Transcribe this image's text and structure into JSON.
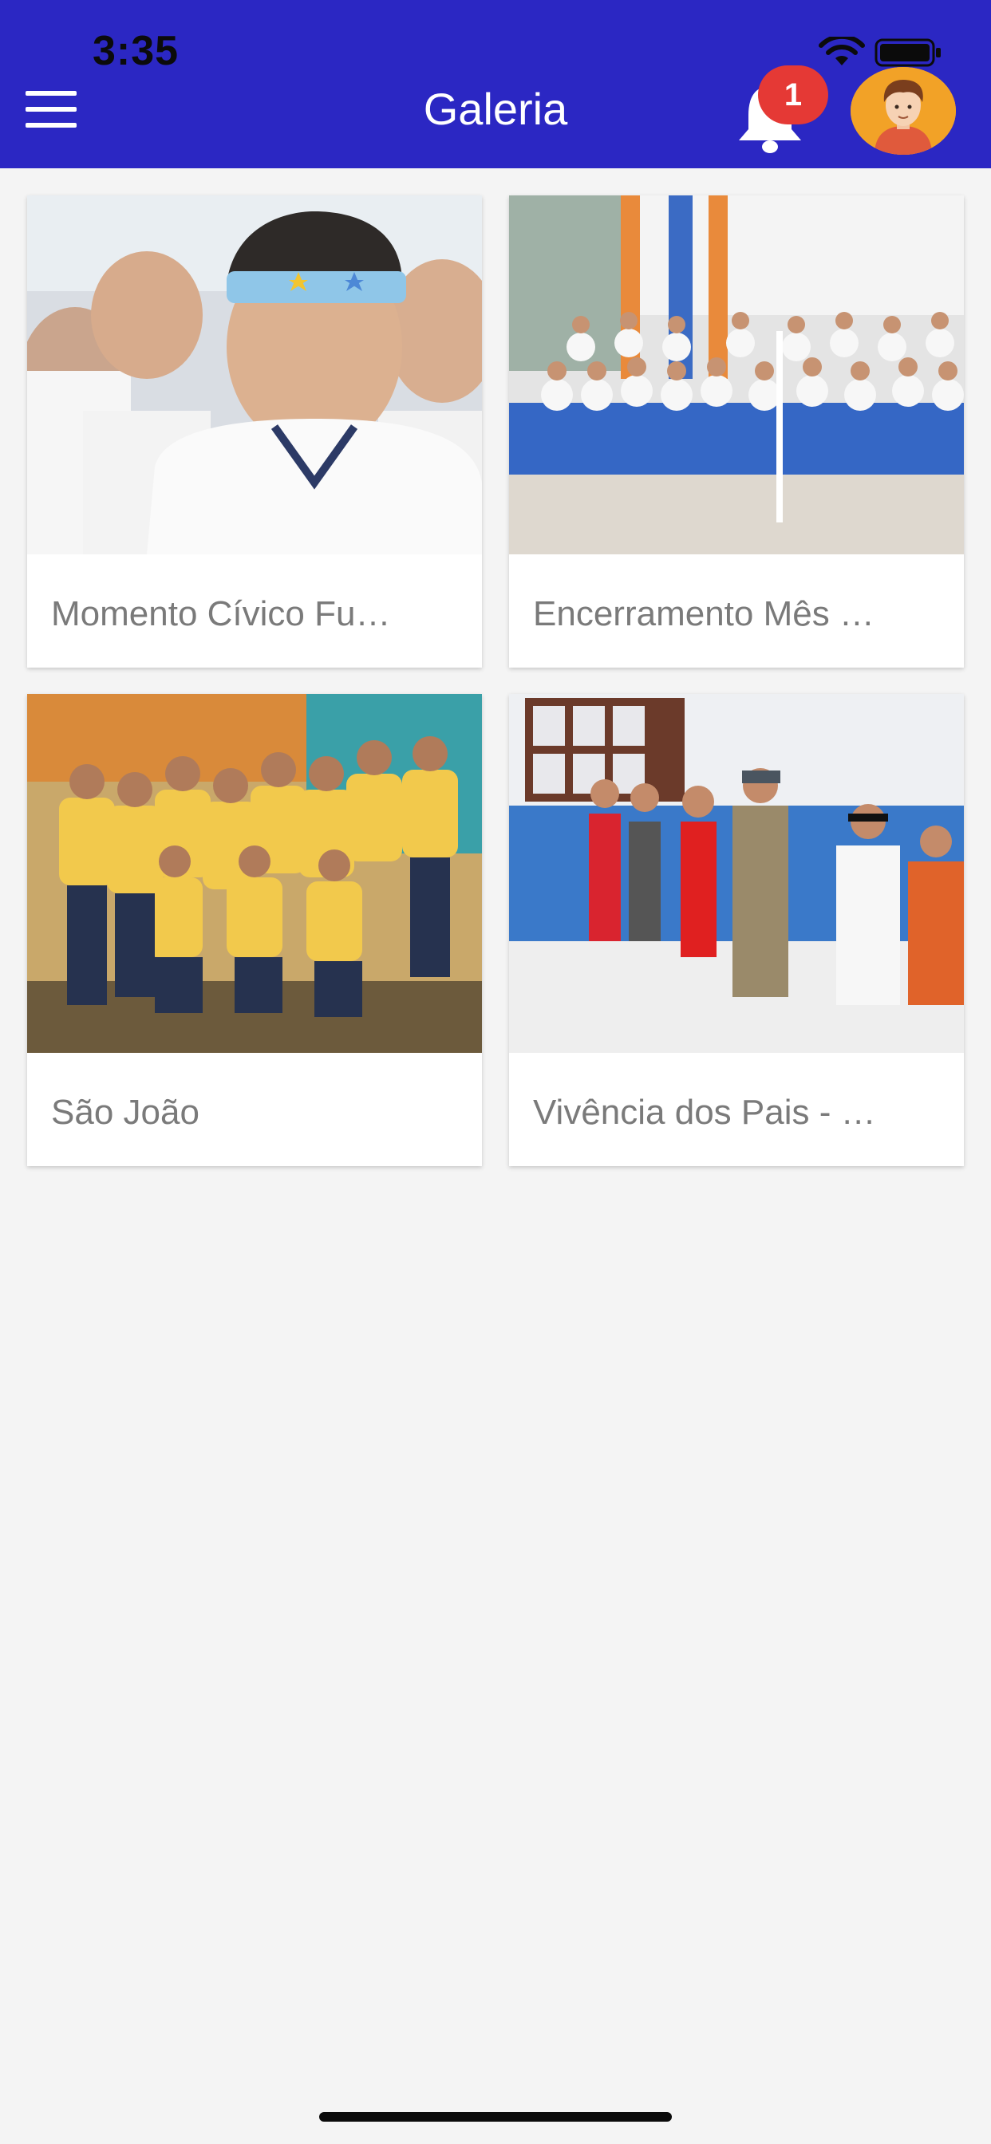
{
  "status_bar": {
    "time": "3:35"
  },
  "header": {
    "title": "Galeria",
    "notification_count": "1",
    "background_color": "#2b27c3",
    "badge_color": "#e53935",
    "icons": {
      "menu": "hamburger-menu-icon",
      "notifications": "bell-icon",
      "profile": "avatar-icon"
    }
  },
  "gallery": {
    "albums": [
      {
        "title": "Momento Cívico Fu…",
        "photo": "children with star headbands and face paint"
      },
      {
        "title": "Encerramento Mês …",
        "photo": "group of students seated on blue steps"
      },
      {
        "title": "São João",
        "photo": "teachers in festive uniforms posing together"
      },
      {
        "title": "Vivência dos Pais - …",
        "photo": "children dressed up as parents in a line"
      }
    ]
  }
}
